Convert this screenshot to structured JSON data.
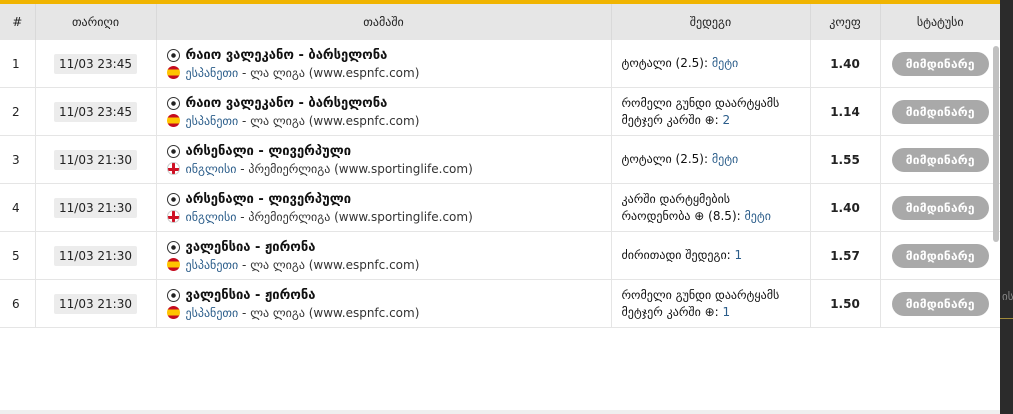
{
  "header": {
    "col_num": "#",
    "col_date": "თარიღი",
    "col_match": "თამაში",
    "col_bet": "შედეგი",
    "col_coef": "კოეფ",
    "col_status": "სტატუსი"
  },
  "rows": [
    {
      "num": "1",
      "time": "11/03 23:45",
      "match": "რაიო ვალეკანო - ბარსელონა",
      "country": "ესპანეთი",
      "league": " - ლა ლიგა (www.espnfc.com)",
      "flag": "es",
      "bet_line1": "ტოტალი (2.5): ",
      "bet_line1_val": "მეტი",
      "bet_line2": "",
      "bet_line2_val": "",
      "coef": "1.40",
      "status": "მიმდინარე"
    },
    {
      "num": "2",
      "time": "11/03 23:45",
      "match": "რაიო ვალეკანო - ბარსელონა",
      "country": "ესპანეთი",
      "league": " - ლა ლიგა (www.espnfc.com)",
      "flag": "es",
      "bet_line1": "რომელი გუნდი დაარტყამს",
      "bet_line1_val": "",
      "bet_line2": "მეტჯერ კარში ⊕: ",
      "bet_line2_val": "2",
      "coef": "1.14",
      "status": "მიმდინარე"
    },
    {
      "num": "3",
      "time": "11/03 21:30",
      "match": "არსენალი - ლივერპული",
      "country": "ინგლისი",
      "league": " - პრემიერლიგა (www.sportinglife.com)",
      "flag": "en",
      "bet_line1": "ტოტალი (2.5): ",
      "bet_line1_val": "მეტი",
      "bet_line2": "",
      "bet_line2_val": "",
      "coef": "1.55",
      "status": "მიმდინარე"
    },
    {
      "num": "4",
      "time": "11/03 21:30",
      "match": "არსენალი - ლივერპული",
      "country": "ინგლისი",
      "league": " - პრემიერლიგა (www.sportinglife.com)",
      "flag": "en",
      "bet_line1": "კარში დარტყმების",
      "bet_line1_val": "",
      "bet_line2": "რაოდენობა ⊕ (8.5): ",
      "bet_line2_val": "მეტი",
      "coef": "1.40",
      "status": "მიმდინარე"
    },
    {
      "num": "5",
      "time": "11/03 21:30",
      "match": "ვალენსია - ჟირონა",
      "country": "ესპანეთი",
      "league": " - ლა ლიგა (www.espnfc.com)",
      "flag": "es",
      "bet_line1": "ძირითადი შედეგი: ",
      "bet_line1_val": "1",
      "bet_line2": "",
      "bet_line2_val": "",
      "coef": "1.57",
      "status": "მიმდინარე"
    },
    {
      "num": "6",
      "time": "11/03 21:30",
      "match": "ვალენსია - ჟირონა",
      "country": "ესპანეთი",
      "league": " - ლა ლიგა (www.espnfc.com)",
      "flag": "es",
      "bet_line1": "რომელი გუნდი დაარტყამს",
      "bet_line1_val": "",
      "bet_line2": "მეტჯერ კარში ⊕: ",
      "bet_line2_val": "1",
      "coef": "1.50",
      "status": "მიმდინარე"
    }
  ],
  "edge_text": "ის"
}
